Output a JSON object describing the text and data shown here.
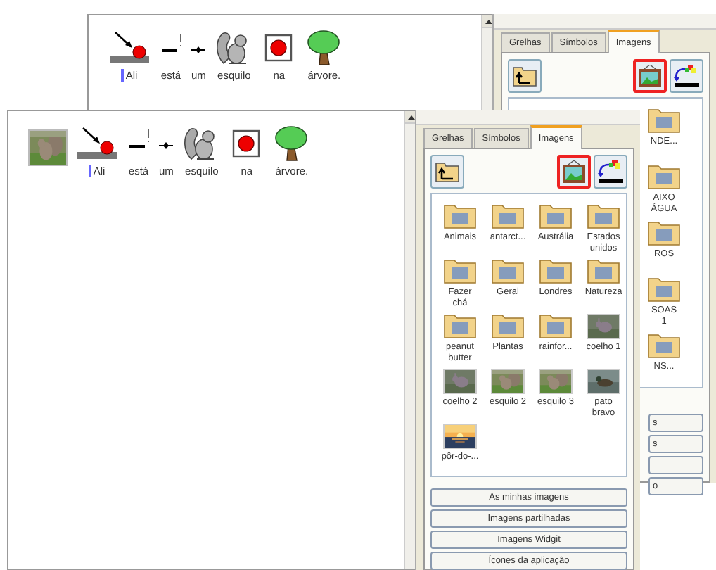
{
  "back_document": {
    "sentence": [
      {
        "word": "Ali",
        "kind": "arrow-ball",
        "cursor": true
      },
      {
        "word": "está",
        "kind": "dash-bang",
        "cursor": false
      },
      {
        "word": "um",
        "kind": "dot-dash",
        "cursor": false
      },
      {
        "word": "esquilo",
        "kind": "squirrel",
        "cursor": false
      },
      {
        "word": "na",
        "kind": "boxed-dot",
        "cursor": false
      },
      {
        "word": "árvore.",
        "kind": "tree",
        "cursor": false
      }
    ]
  },
  "back_panel": {
    "tabs": [
      {
        "label": "Grelhas",
        "selected": false
      },
      {
        "label": "Símbolos",
        "selected": false
      },
      {
        "label": "Imagens",
        "selected": true
      }
    ],
    "items": [
      {
        "label": "NDE...",
        "kind": "folder"
      },
      {
        "label": "AIXO\nÁGUA",
        "kind": "folder"
      },
      {
        "label": "ROS",
        "kind": "folder"
      },
      {
        "label": "SOAS\n1",
        "kind": "folder"
      },
      {
        "label": "NS...",
        "kind": "folder"
      }
    ],
    "buttons": [
      {
        "kind": "label",
        "label": "s"
      },
      {
        "kind": "label",
        "label": "s"
      },
      {
        "kind": "blank"
      },
      {
        "kind": "label",
        "label": "o"
      }
    ]
  },
  "front_document": {
    "sentence": [
      {
        "word": "Ali",
        "kind": "arrow-ball",
        "cursor": true
      },
      {
        "word": "está",
        "kind": "dash-bang",
        "cursor": false
      },
      {
        "word": "um",
        "kind": "dot-dash",
        "cursor": false
      },
      {
        "word": "esquilo",
        "kind": "squirrel",
        "cursor": false
      },
      {
        "word": "na",
        "kind": "boxed-dot",
        "cursor": false
      },
      {
        "word": "árvore.",
        "kind": "tree",
        "cursor": false
      }
    ]
  },
  "front_panel": {
    "tabs": [
      {
        "label": "Grelhas",
        "selected": false
      },
      {
        "label": "Símbolos",
        "selected": false
      },
      {
        "label": "Imagens",
        "selected": true
      }
    ],
    "items": [
      {
        "label": "Animais",
        "kind": "folder"
      },
      {
        "label": "antarct...",
        "kind": "folder"
      },
      {
        "label": "Austrália",
        "kind": "folder"
      },
      {
        "label": "Estados\nunidos",
        "kind": "folder"
      },
      {
        "label": "Fazer\nchá",
        "kind": "folder"
      },
      {
        "label": "Geral",
        "kind": "folder"
      },
      {
        "label": "Londres",
        "kind": "folder"
      },
      {
        "label": "Natureza",
        "kind": "folder"
      },
      {
        "label": "peanut\nbutter",
        "kind": "folder"
      },
      {
        "label": "Plantas",
        "kind": "folder"
      },
      {
        "label": "rainfor...",
        "kind": "folder"
      },
      {
        "label": "coelho 1"
      },
      {
        "label": "coelho 2"
      },
      {
        "label": "esquilo 2"
      },
      {
        "label": "esquilo 3"
      },
      {
        "label": "pato\nbravo"
      },
      {
        "label": "pôr-do-..."
      }
    ],
    "buttons": [
      {
        "label": "As minhas imagens"
      },
      {
        "label": "Imagens partilhadas"
      },
      {
        "label": "Imagens Widgit"
      },
      {
        "label": "Ícones da aplicação"
      }
    ]
  }
}
